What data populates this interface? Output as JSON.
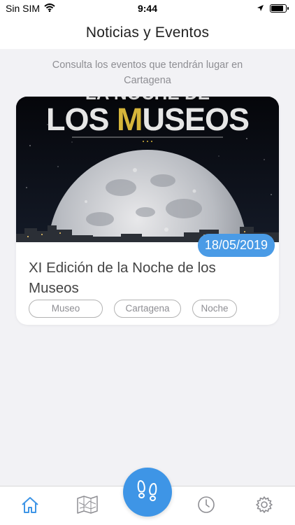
{
  "status_bar": {
    "carrier": "Sin SIM",
    "time": "9:44"
  },
  "header": {
    "title": "Noticias y Eventos"
  },
  "intro": {
    "text": "Consulta los eventos que tendrán lugar en Cartagena"
  },
  "events": [
    {
      "image_text_line1": "LA NOCHE DE",
      "image_text_line2_a": "LOS ",
      "image_text_line2_b": "M",
      "image_text_line2_c": "USEOS",
      "date": "18/05/2019",
      "title": "XI Edición de la Noche de los Museos",
      "tags": [
        "Museo",
        "Cartagena",
        "Noche"
      ]
    }
  ],
  "tab_bar": {
    "items": [
      "home-icon",
      "map-icon",
      "footprints-icon",
      "clock-icon",
      "gear-icon"
    ],
    "active": "home-icon"
  },
  "colors": {
    "accent": "#3e95e6",
    "badge": "#4a9be6",
    "title_text": "#444444"
  }
}
